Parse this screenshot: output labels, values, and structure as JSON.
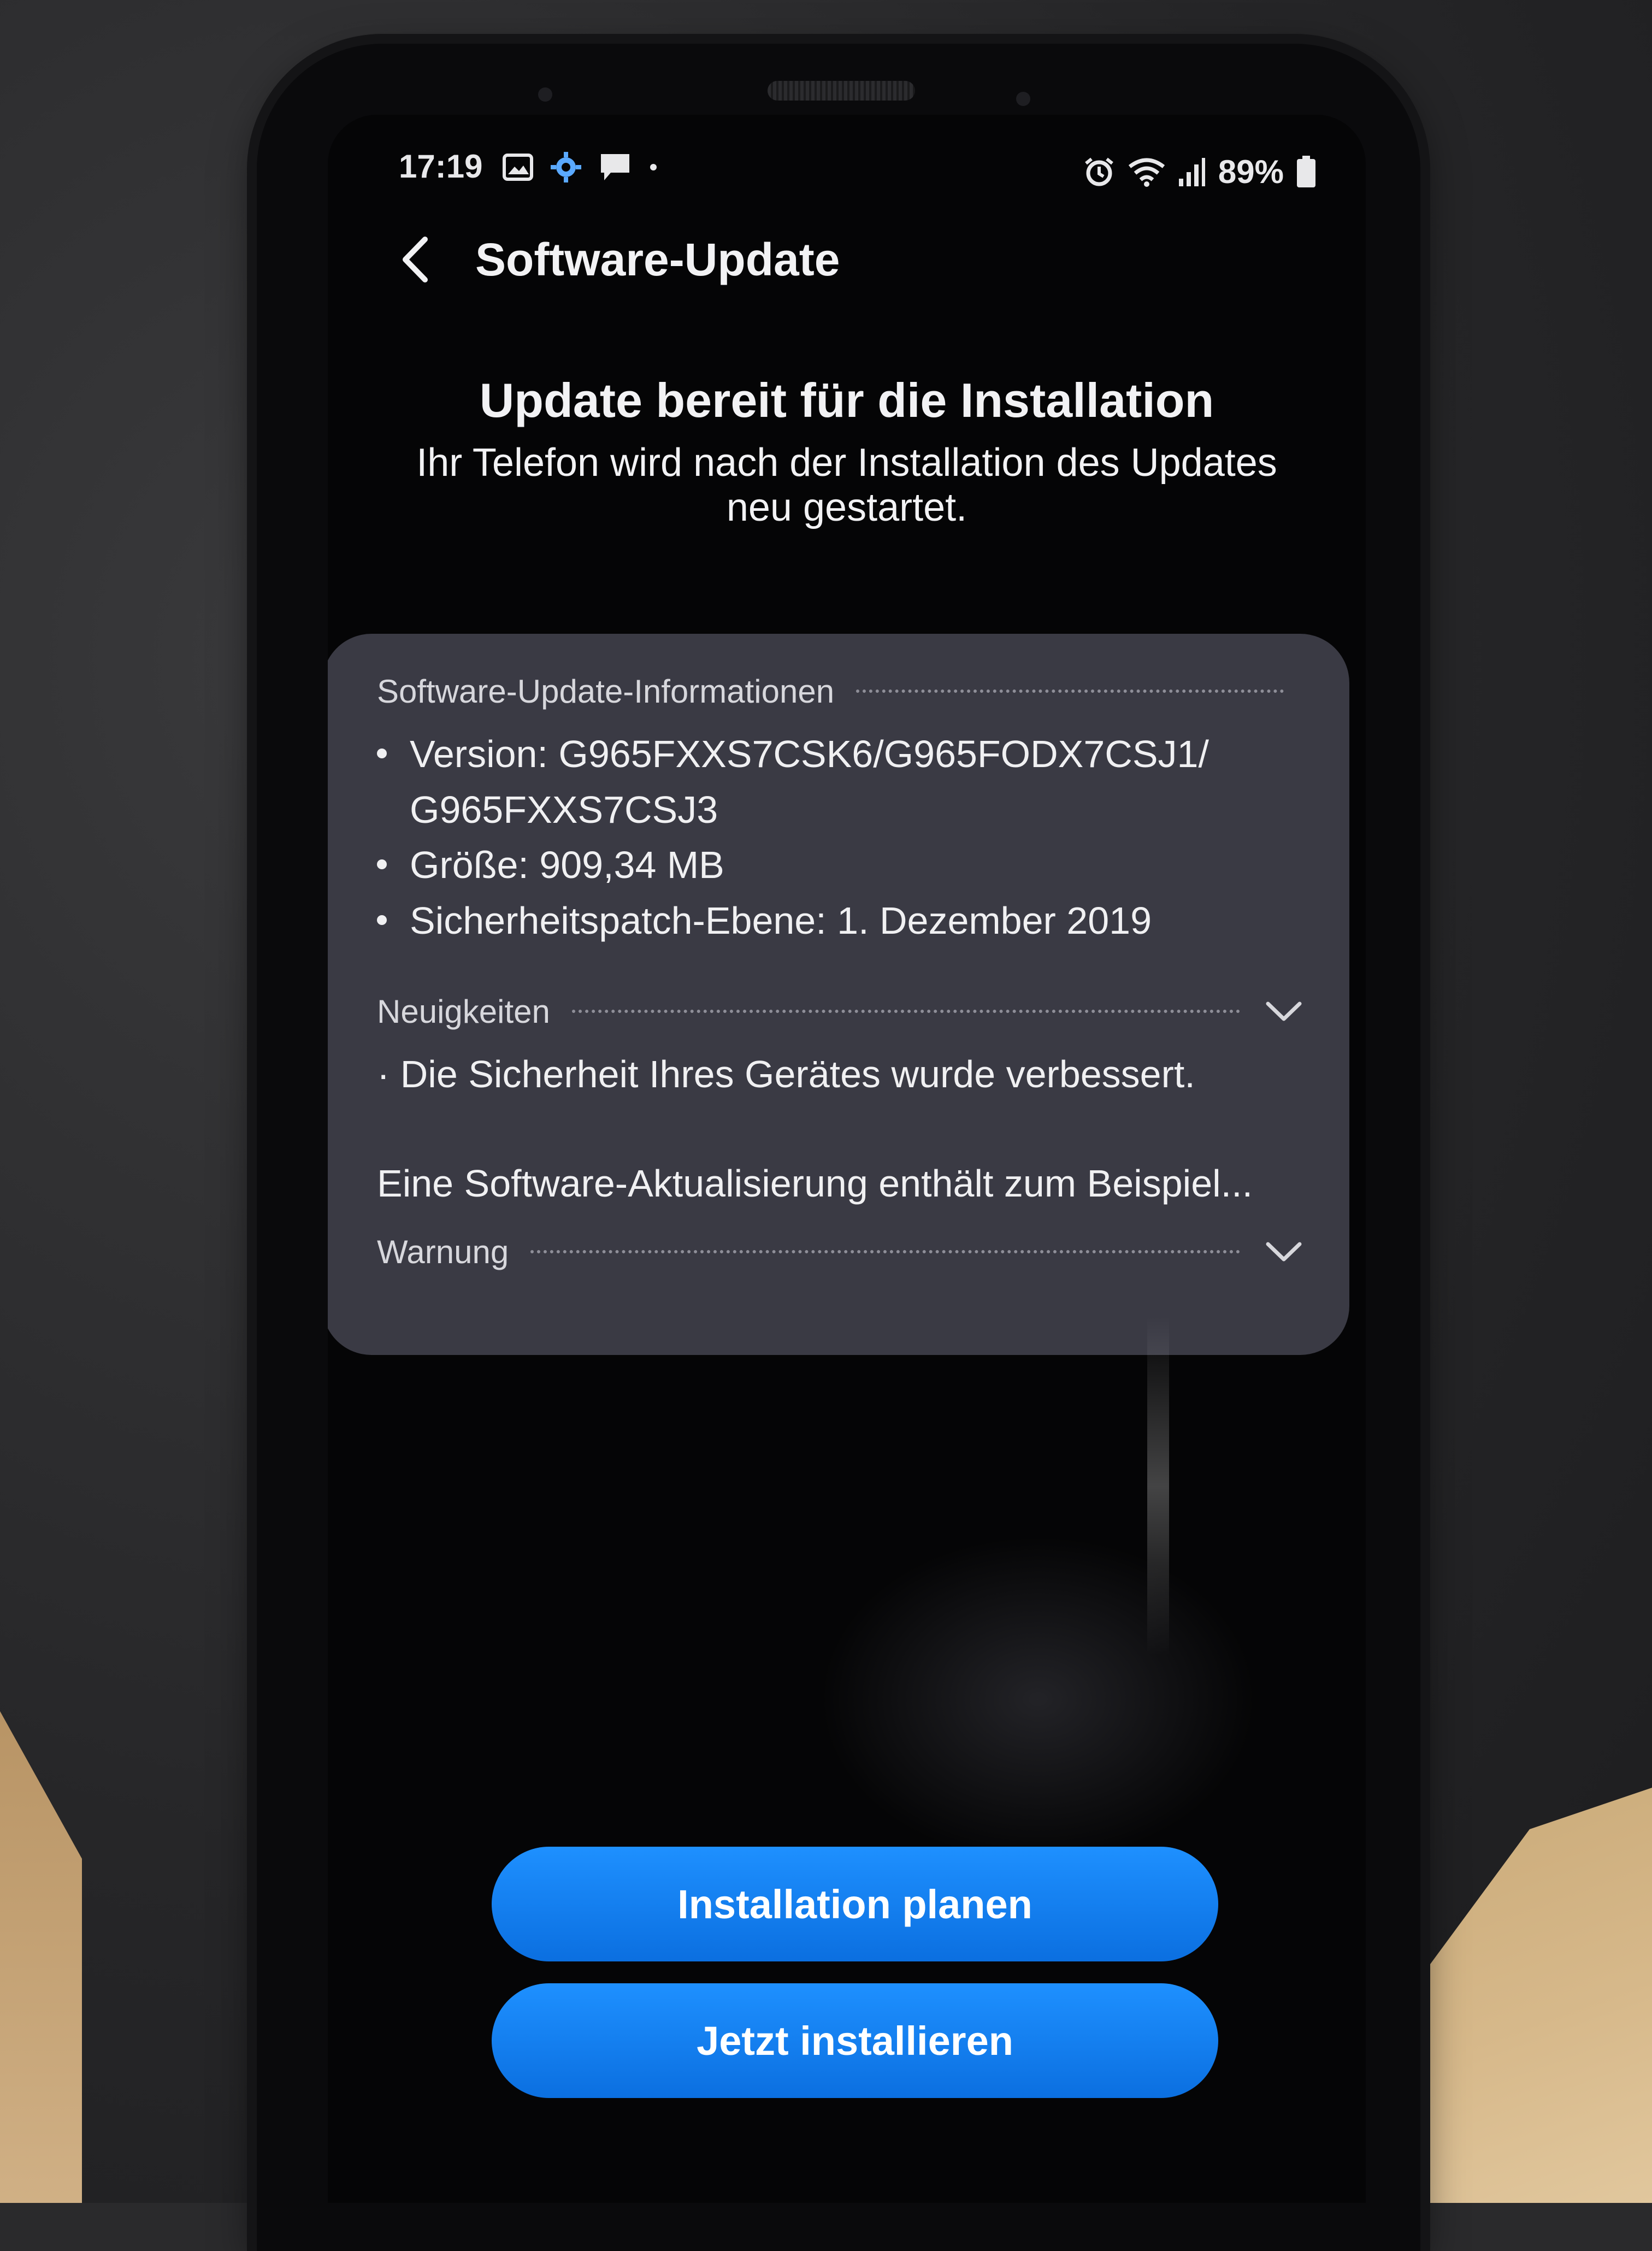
{
  "status_bar": {
    "time": "17:19",
    "battery": "89%",
    "left_icons": [
      "gallery-icon",
      "settings-icon",
      "message-icon",
      "dot-icon"
    ],
    "right_icons": [
      "alarm-icon",
      "wifi-icon",
      "signal-icon",
      "battery-icon"
    ]
  },
  "appbar": {
    "title": "Software-Update"
  },
  "hero": {
    "title": "Update bereit für die Installation",
    "subtitle": "Ihr Telefon wird nach der Installation des Updates neu gestartet."
  },
  "card": {
    "info_header": "Software-Update-Informationen",
    "info_items": [
      "Version: G965FXXS7CSK6/G965FODX7CSJ1/ G965FXXS7CSJ3",
      "Größe: 909,34 MB",
      "Sicherheitspatch-Ebene: 1. Dezember 2019"
    ],
    "news_header": "Neuigkeiten",
    "news_text": "· Die Sicherheit Ihres Gerätes wurde verbessert.",
    "example_text": "Eine Software-Aktualisierung enthält zum Beispiel...",
    "warning_header": "Warnung"
  },
  "buttons": {
    "plan": "Installation planen",
    "now": "Jetzt installieren"
  },
  "colors": {
    "accent": "#1e90ff",
    "card_bg": "#3a3a44",
    "screen_bg": "#050506"
  }
}
